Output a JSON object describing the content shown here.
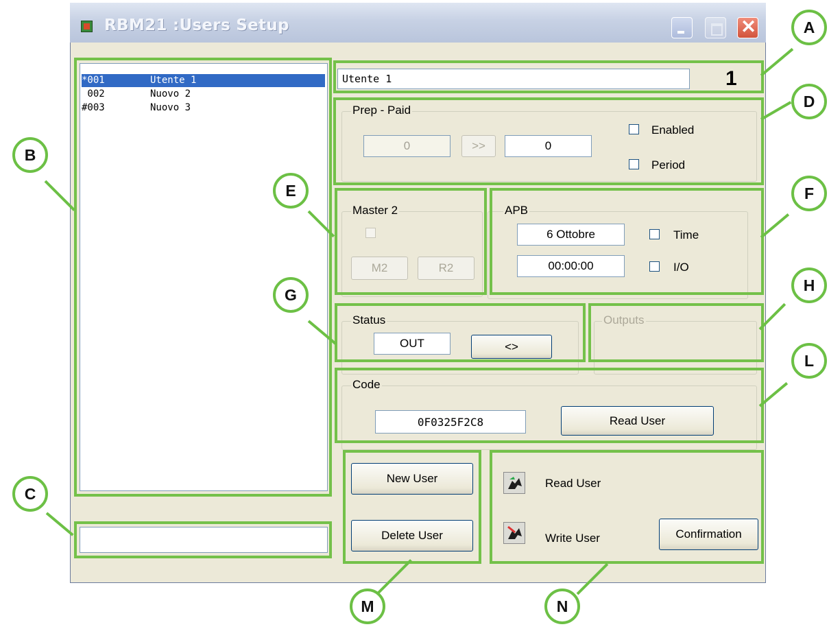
{
  "window": {
    "title": "RBM21 :Users Setup"
  },
  "user_list": {
    "items": [
      {
        "code": "*001",
        "name": "Utente 1",
        "selected": true
      },
      {
        "code": " 002",
        "name": "Nuovo 2",
        "selected": false
      },
      {
        "code": "#003",
        "name": "Nuovo 3",
        "selected": false
      }
    ]
  },
  "bottom_status_field": {
    "value": ""
  },
  "user_name": {
    "value": "Utente 1",
    "number": "1"
  },
  "prepaid": {
    "legend": "Prep - Paid",
    "value_left": "0",
    "arrow_label": ">>",
    "value_right": "0",
    "enabled_label": "Enabled",
    "period_label": "Period"
  },
  "master2": {
    "legend": "Master 2",
    "m2_label": "M2",
    "r2_label": "R2"
  },
  "apb": {
    "legend": "APB",
    "date": "6 Ottobre",
    "time": "00:00:00",
    "time_label": "Time",
    "io_label": "I/O"
  },
  "status": {
    "legend": "Status",
    "value": "OUT",
    "toggle_label": "<>"
  },
  "outputs": {
    "legend": "Outputs"
  },
  "code": {
    "legend": "Code",
    "value": "0F0325F2C8",
    "read_label": "Read User"
  },
  "actions": {
    "new_user": "New User",
    "delete_user": "Delete User"
  },
  "device": {
    "read_user": "Read User",
    "write_user": "Write User",
    "confirmation": "Confirmation"
  },
  "callouts": [
    "A",
    "B",
    "C",
    "D",
    "E",
    "F",
    "G",
    "H",
    "L",
    "M",
    "N"
  ],
  "colors": {
    "callout_green": "#74c14a",
    "selection_blue": "#316ac5",
    "window_bg": "#ece9d8"
  }
}
